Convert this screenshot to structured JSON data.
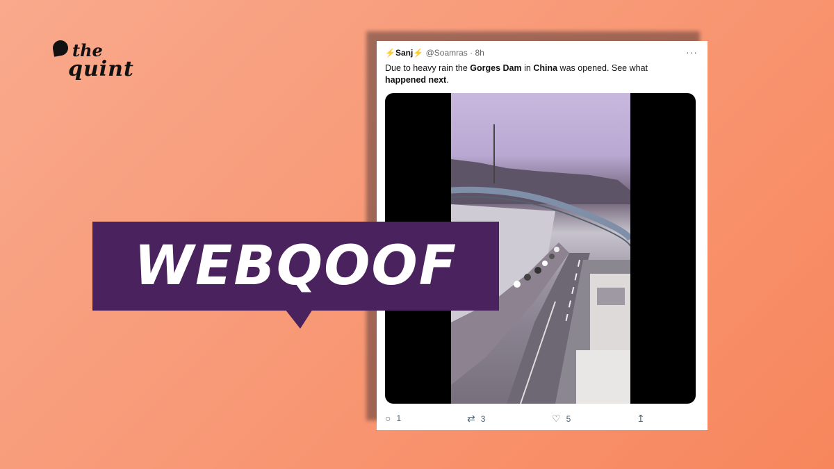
{
  "brand": {
    "line1": "the",
    "line2": "quint"
  },
  "tweet": {
    "name": "⚡Sanj⚡",
    "handle": "@Soamras",
    "separator": "·",
    "time": "8h",
    "more": "···",
    "text_parts": [
      "Due to heavy rain the ",
      "Gorges Dam",
      " in ",
      "China",
      " was opened. See what ",
      "happened next",
      "."
    ],
    "actions": {
      "reply": {
        "icon": "reply-icon",
        "count": "1"
      },
      "retweet": {
        "icon": "retweet-icon",
        "count": "3"
      },
      "like": {
        "icon": "heart-icon",
        "count": "5"
      },
      "share": {
        "icon": "share-icon"
      }
    }
  },
  "banner": {
    "text": "WEBQOOF"
  },
  "colors": {
    "background": "#f89a78",
    "banner": "#4a235e"
  }
}
